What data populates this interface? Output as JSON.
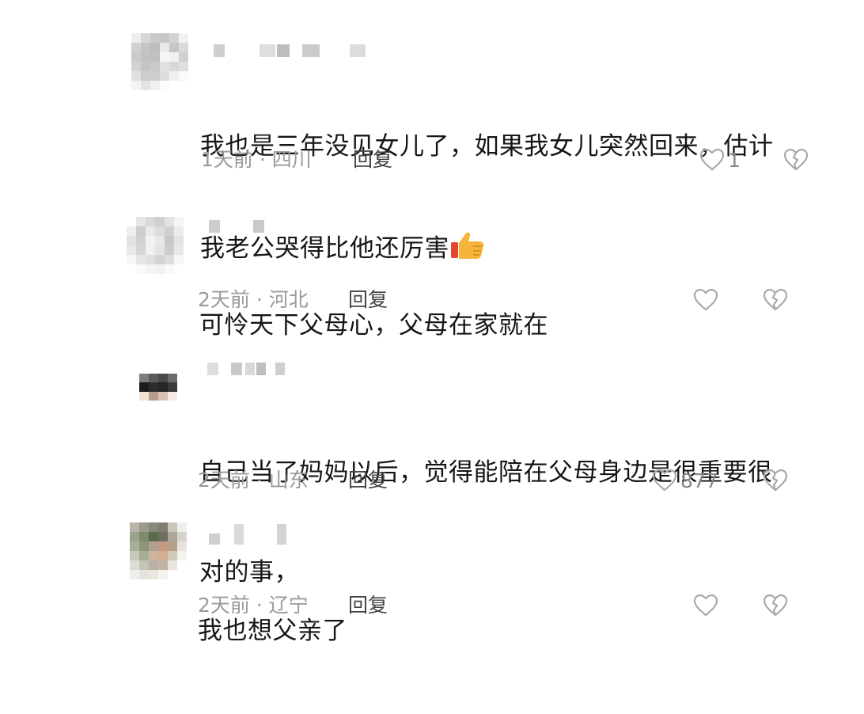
{
  "comments": [
    {
      "text_line1": "我也是三年没见女儿了，如果我女儿突然回来，估计",
      "text_line2": "我老公哭得比他还厉害",
      "emoji": "thumbs-up-icon",
      "time": "1天前",
      "sep": "·",
      "location": "四川",
      "reply": "回复",
      "likes": "1"
    },
    {
      "text_line1": "可怜天下父母心，父母在家就在",
      "time": "2天前",
      "sep": "·",
      "location": "河北",
      "reply": "回复",
      "likes": ""
    },
    {
      "text_line1": "自己当了妈妈以后，觉得能陪在父母身边是很重要很",
      "text_line2": "对的事，",
      "time": "2天前",
      "sep": "·",
      "location": "山东",
      "reply": "回复",
      "likes": "877"
    },
    {
      "text_line1": "我也想父亲了",
      "time": "2天前",
      "sep": "·",
      "location": "辽宁",
      "reply": "回复",
      "likes": ""
    }
  ],
  "colors": {
    "meta": "#9a9a9a",
    "reply": "#444444",
    "text": "#161616",
    "icon": "#b0b0b0"
  }
}
